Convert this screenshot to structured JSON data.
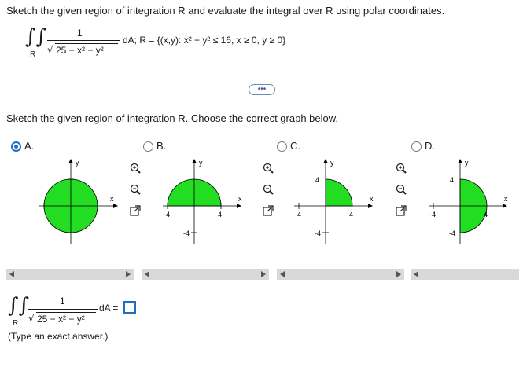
{
  "question": {
    "instruction": "Sketch the given region of integration R and evaluate the integral over R using polar coordinates.",
    "integral": {
      "numerator": "1",
      "denominator": "25 − x² − y²",
      "region_sub": "R",
      "region": "dA; R = {(x,y): x² + y² ≤ 16, x ≥ 0, y ≥ 0}"
    }
  },
  "more_button": "•••",
  "part1": {
    "instruction": "Sketch the given region of integration R. Choose the correct graph below."
  },
  "options": [
    {
      "label": "A.",
      "selected": true,
      "region": "full-disk"
    },
    {
      "label": "B.",
      "selected": false,
      "region": "upper-half"
    },
    {
      "label": "C.",
      "selected": false,
      "region": "first-quadrant"
    },
    {
      "label": "D.",
      "selected": false,
      "region": "right-half"
    }
  ],
  "axis_labels": {
    "x": "x",
    "y": "y",
    "p4": "4",
    "m4": "-4"
  },
  "part2": {
    "numerator": "1",
    "denominator": "25 − x² − y²",
    "region_sub": "R",
    "dA": "dA =",
    "hint": "(Type an exact answer.)"
  },
  "colors": {
    "fill": "#22dd22",
    "accent": "#1d6fc7"
  }
}
